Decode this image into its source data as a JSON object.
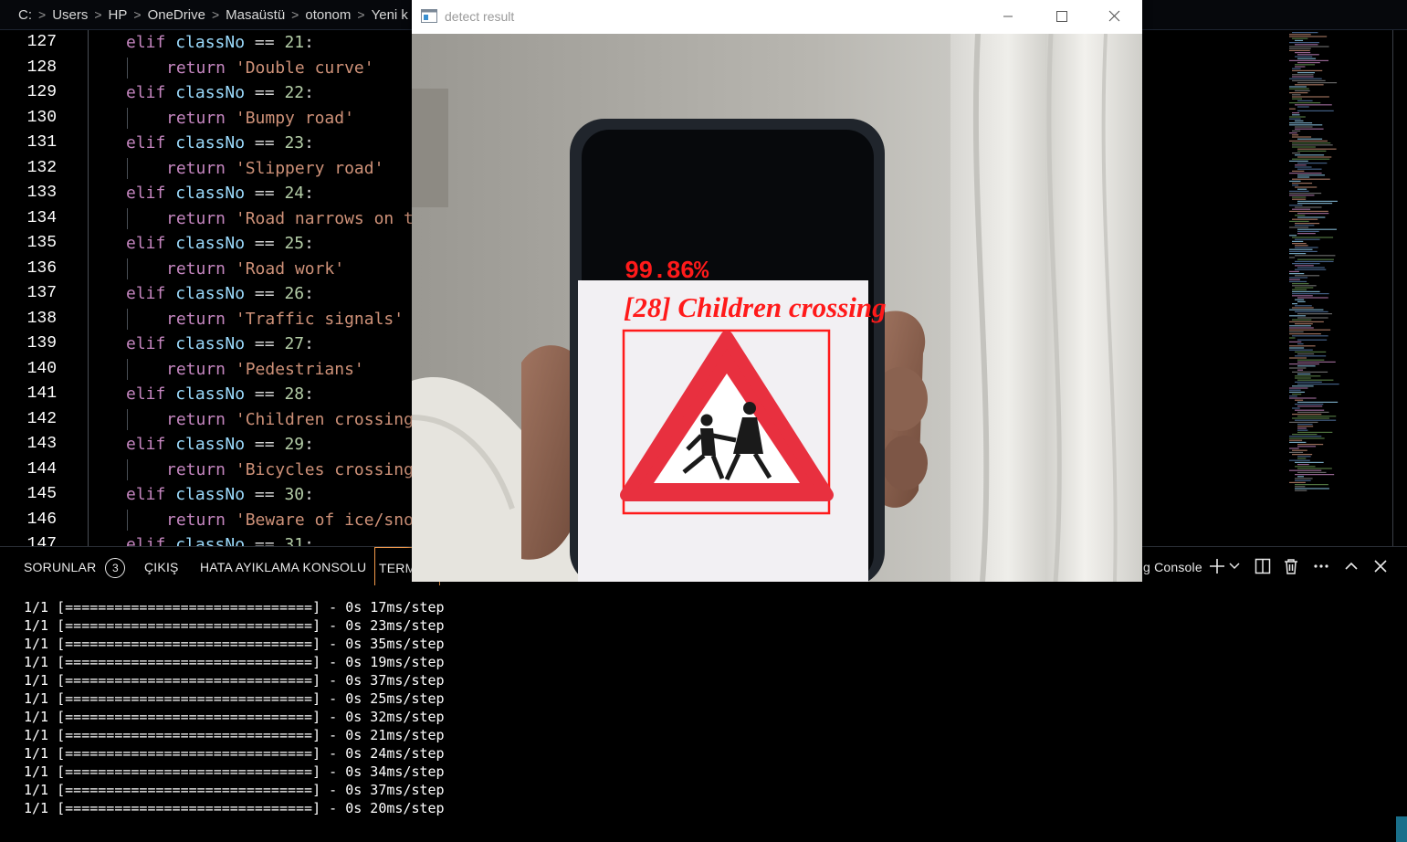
{
  "breadcrumb": [
    "C:",
    "Users",
    "HP",
    "OneDrive",
    "Masaüstü",
    "otonom",
    "Yeni k"
  ],
  "editor": {
    "lines": [
      {
        "no": "127",
        "indent": 1,
        "kw": "elif",
        "var": "classNo",
        "op": "==",
        "num": "21",
        "tail": ":"
      },
      {
        "no": "128",
        "indent": 2,
        "kw": "return",
        "str": "'Double curve'"
      },
      {
        "no": "129",
        "indent": 1,
        "kw": "elif",
        "var": "classNo",
        "op": "==",
        "num": "22",
        "tail": ":"
      },
      {
        "no": "130",
        "indent": 2,
        "kw": "return",
        "str": "'Bumpy road'"
      },
      {
        "no": "131",
        "indent": 1,
        "kw": "elif",
        "var": "classNo",
        "op": "==",
        "num": "23",
        "tail": ":"
      },
      {
        "no": "132",
        "indent": 2,
        "kw": "return",
        "str": "'Slippery road'"
      },
      {
        "no": "133",
        "indent": 1,
        "kw": "elif",
        "var": "classNo",
        "op": "==",
        "num": "24",
        "tail": ":"
      },
      {
        "no": "134",
        "indent": 2,
        "kw": "return",
        "str": "'Road narrows on t"
      },
      {
        "no": "135",
        "indent": 1,
        "kw": "elif",
        "var": "classNo",
        "op": "==",
        "num": "25",
        "tail": ":"
      },
      {
        "no": "136",
        "indent": 2,
        "kw": "return",
        "str": "'Road work'"
      },
      {
        "no": "137",
        "indent": 1,
        "kw": "elif",
        "var": "classNo",
        "op": "==",
        "num": "26",
        "tail": ":"
      },
      {
        "no": "138",
        "indent": 2,
        "kw": "return",
        "str": "'Traffic signals'"
      },
      {
        "no": "139",
        "indent": 1,
        "kw": "elif",
        "var": "classNo",
        "op": "==",
        "num": "27",
        "tail": ":"
      },
      {
        "no": "140",
        "indent": 2,
        "kw": "return",
        "str": "'Pedestrians'"
      },
      {
        "no": "141",
        "indent": 1,
        "kw": "elif",
        "var": "classNo",
        "op": "==",
        "num": "28",
        "tail": ":"
      },
      {
        "no": "142",
        "indent": 2,
        "kw": "return",
        "str": "'Children crossing"
      },
      {
        "no": "143",
        "indent": 1,
        "kw": "elif",
        "var": "classNo",
        "op": "==",
        "num": "29",
        "tail": ":"
      },
      {
        "no": "144",
        "indent": 2,
        "kw": "return",
        "str": "'Bicycles crossing"
      },
      {
        "no": "145",
        "indent": 1,
        "kw": "elif",
        "var": "classNo",
        "op": "==",
        "num": "30",
        "tail": ":"
      },
      {
        "no": "146",
        "indent": 2,
        "kw": "return",
        "str": "'Beware of ice/sno"
      },
      {
        "no": "147",
        "indent": 1,
        "kw": "elif",
        "var": "classNo",
        "op": "==",
        "num": "31",
        "tail": ":"
      }
    ]
  },
  "panel": {
    "tabs": {
      "problems": "SORUNLAR",
      "problems_count": "3",
      "output": "ÇIKIŞ",
      "debug_console": "HATA AYIKLAMA KONSOLU",
      "terminal": "TERM",
      "terminal_select": "g Console"
    },
    "terminal_lines": [
      "1/1 [==============================] - 0s 17ms/step",
      "1/1 [==============================] - 0s 23ms/step",
      "1/1 [==============================] - 0s 35ms/step",
      "1/1 [==============================] - 0s 19ms/step",
      "1/1 [==============================] - 0s 37ms/step",
      "1/1 [==============================] - 0s 25ms/step",
      "1/1 [==============================] - 0s 32ms/step",
      "1/1 [==============================] - 0s 21ms/step",
      "1/1 [==============================] - 0s 24ms/step",
      "1/1 [==============================] - 0s 34ms/step",
      "1/1 [==============================] - 0s 37ms/step",
      "1/1 [==============================] - 0s 20ms/step"
    ],
    "icons": [
      "plus-icon",
      "chevron-down-icon",
      "split-icon",
      "trash-icon",
      "more-icon",
      "chevron-up-icon",
      "close-icon"
    ]
  },
  "cv_window": {
    "title": "detect result",
    "confidence": "99.86%",
    "class_label": "[28] Children crossing",
    "box_color": "#ff1a1a"
  }
}
